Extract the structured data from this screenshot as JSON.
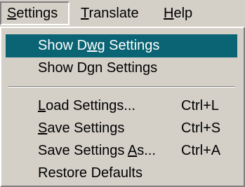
{
  "menubar": {
    "settings": "Settings",
    "translate": "Translate",
    "help": "Help"
  },
  "menu": {
    "items": [
      {
        "label_pre": "Show D",
        "label_acc": "w",
        "label_post": "g Settings",
        "shortcut": ""
      },
      {
        "label_pre": "Show Dgn Settings",
        "label_acc": "",
        "label_post": "",
        "shortcut": ""
      },
      {
        "label_pre": "",
        "label_acc": "L",
        "label_post": "oad Settings...",
        "shortcut": "Ctrl+L"
      },
      {
        "label_pre": "",
        "label_acc": "S",
        "label_post": "ave Settings",
        "shortcut": "Ctrl+S"
      },
      {
        "label_pre": "Save Settings ",
        "label_acc": "A",
        "label_post": "s...",
        "shortcut": "Ctrl+A"
      },
      {
        "label_pre": "Restore Defaults",
        "label_acc": "",
        "label_post": "",
        "shortcut": ""
      }
    ]
  },
  "colors": {
    "highlight": "#0a6474",
    "face": "#d4d0c8"
  }
}
